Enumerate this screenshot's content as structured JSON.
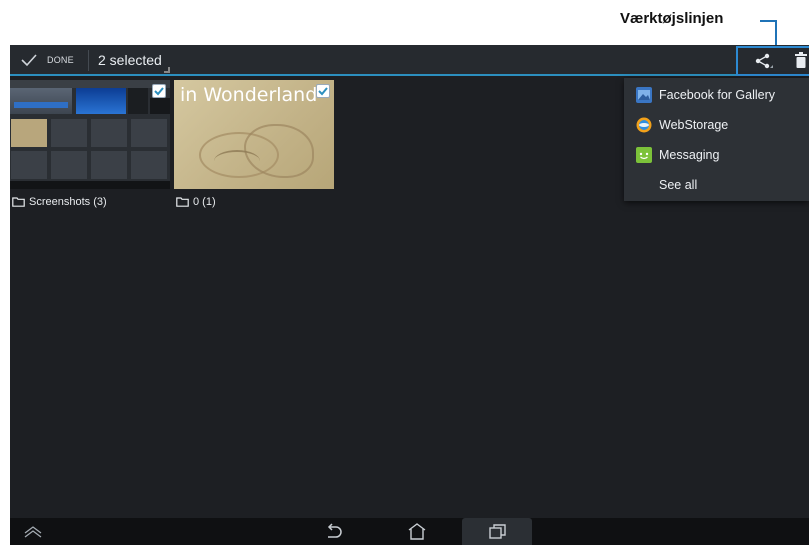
{
  "annotation": {
    "label": "Værktøjslinjen",
    "line_color": "#1f73b7"
  },
  "colors": {
    "accent": "#2c8fbf",
    "highlight_box": "#2d8ad2",
    "screen_bg": "#1d1f23",
    "menu_bg": "#2d3136"
  },
  "action_bar": {
    "done_icon": "checkmark-icon",
    "done_label": "DONE",
    "selection_label": "2 selected",
    "actions": [
      {
        "name": "share",
        "icon": "share-icon"
      },
      {
        "name": "delete",
        "icon": "trash-icon"
      }
    ]
  },
  "albums": [
    {
      "label": "Screenshots (3)",
      "selected": true,
      "icon": "folder-icon"
    },
    {
      "label": "0 (1)",
      "selected": true,
      "thumbnail_text": "in Wonderland",
      "icon": "folder-icon"
    }
  ],
  "share_menu": {
    "items": [
      {
        "label": "Facebook for Gallery",
        "icon": "facebook-gallery-icon"
      },
      {
        "label": "WebStorage",
        "icon": "webstorage-icon"
      },
      {
        "label": "Messaging",
        "icon": "messaging-icon"
      },
      {
        "label": "See all",
        "icon": ""
      }
    ]
  },
  "nav_bar": {
    "buttons": [
      {
        "name": "menu-up",
        "icon": "chevron-up-icon"
      },
      {
        "name": "back",
        "icon": "back-icon"
      },
      {
        "name": "home",
        "icon": "home-icon"
      },
      {
        "name": "recent-apps",
        "icon": "recent-apps-icon"
      }
    ]
  }
}
